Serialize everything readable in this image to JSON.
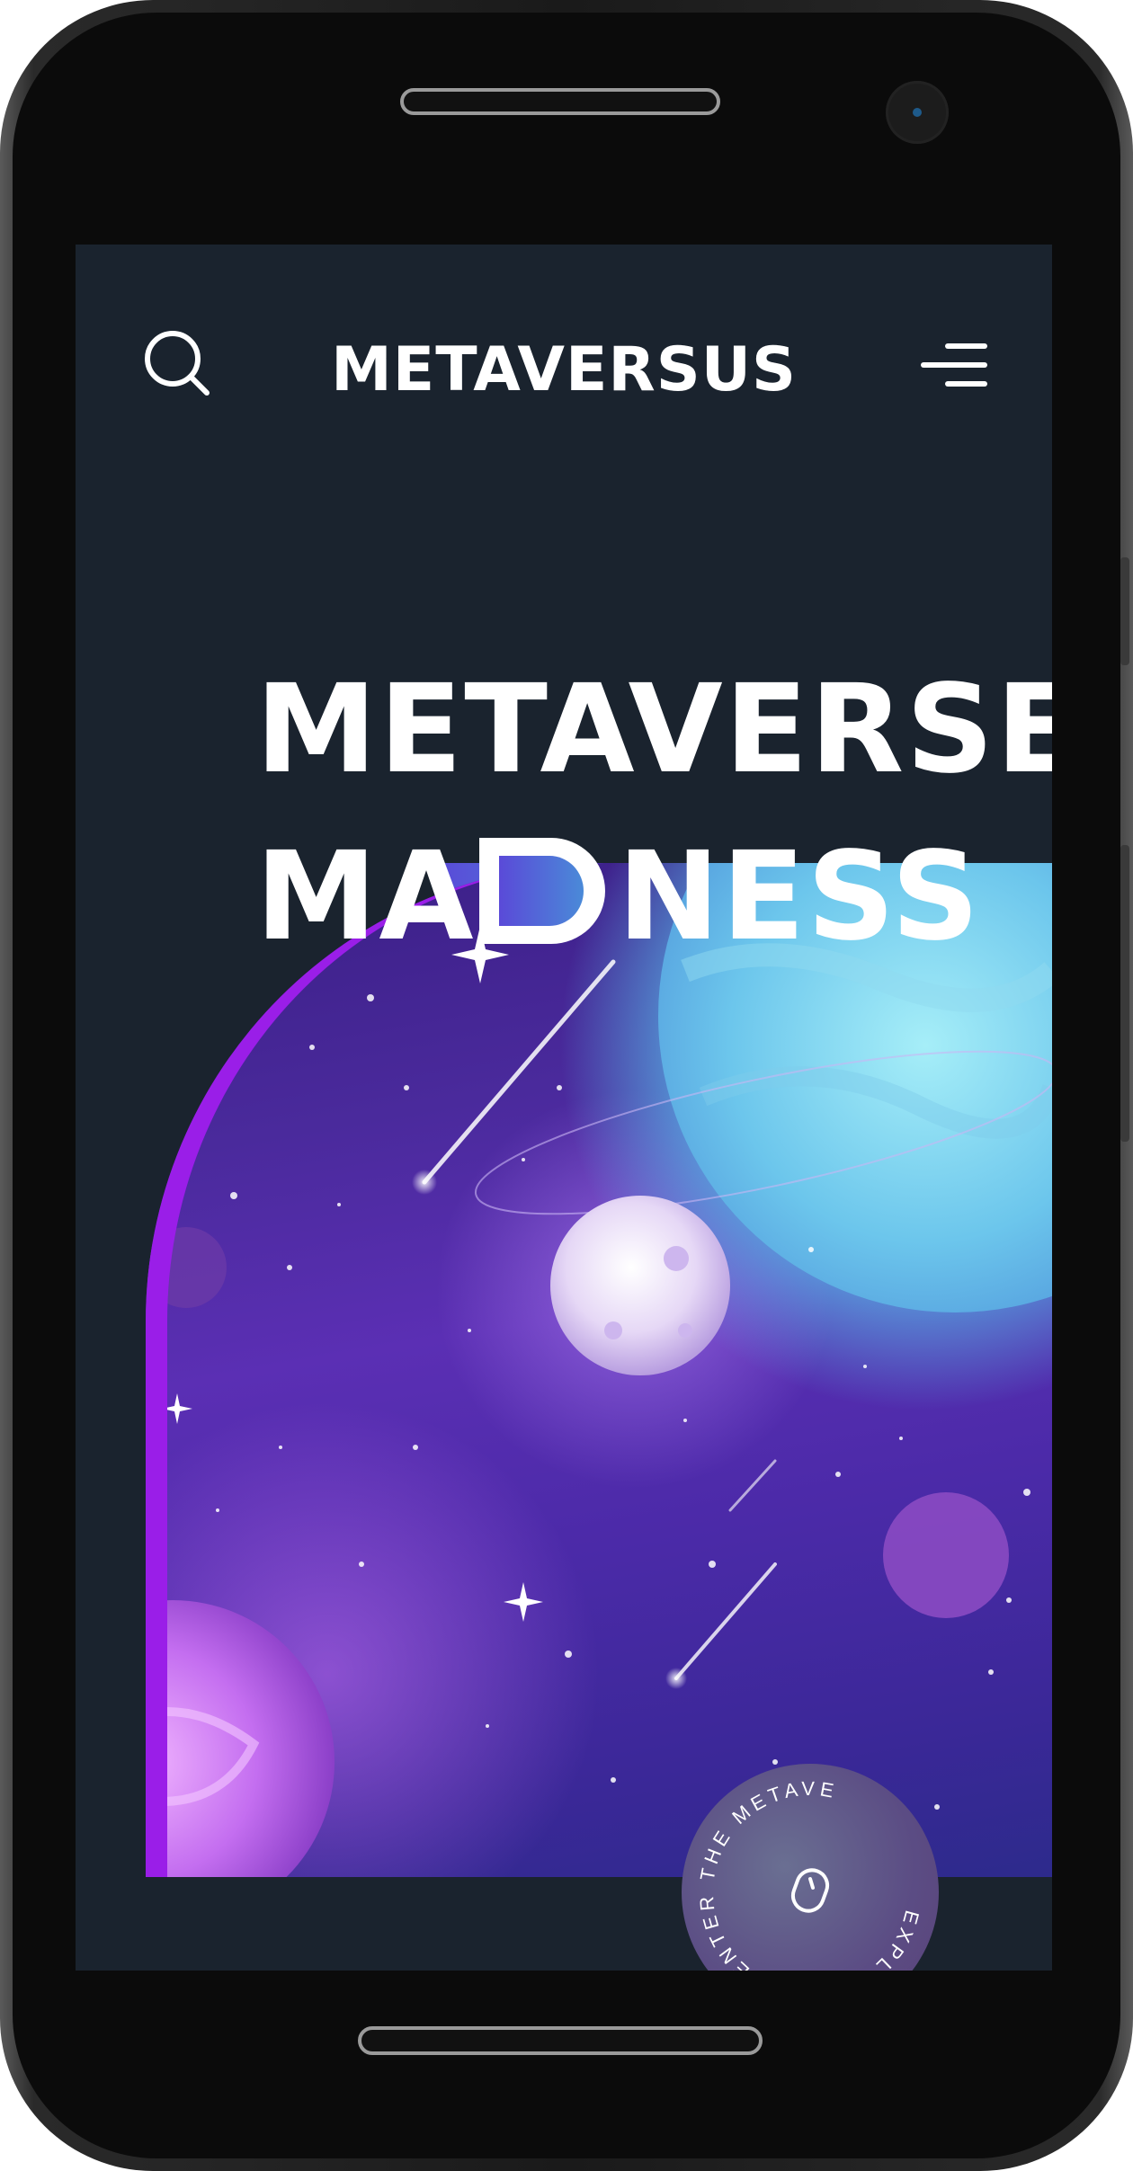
{
  "app": {
    "title": "METAVERSUS"
  },
  "header": {
    "brand": "METAVERSUS",
    "search_icon": "search-icon",
    "menu_icon": "menu-icon"
  },
  "hero": {
    "line1": "METAVERSE",
    "line2_before": "MA",
    "line2_after": "NESS"
  },
  "badge": {
    "text": "EXPLORE AND ENTER THE METAVE",
    "icon": "mouse-icon"
  },
  "colors": {
    "screen_bg": "#1a232e",
    "accent_purple": "#9a1ee8",
    "accent_blue": "#3aa8d0"
  }
}
